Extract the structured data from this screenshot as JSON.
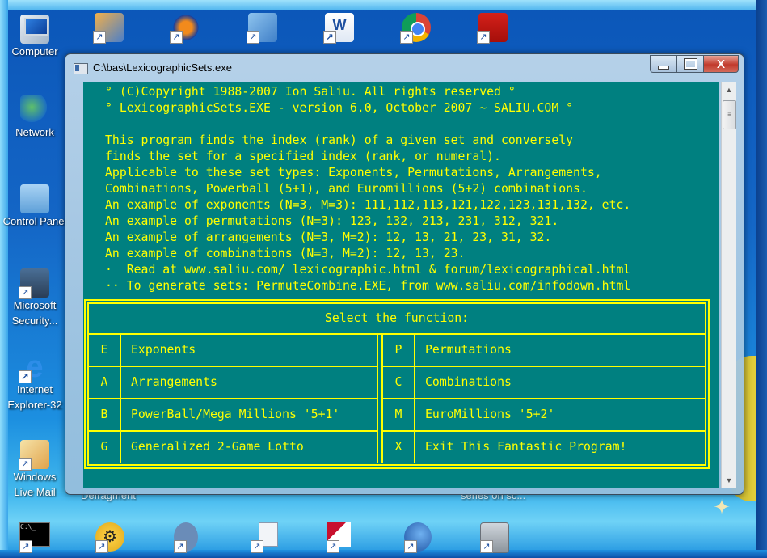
{
  "desktop": {
    "icons_left": [
      {
        "label": "Computer",
        "icon": "computer-icon"
      },
      {
        "label": "Network",
        "icon": "network-icon"
      },
      {
        "label": "Control Panel",
        "icon": "control-panel-icon"
      },
      {
        "label": "Microsoft Security...",
        "icon": "security-shield-icon"
      },
      {
        "label": "Internet Explorer-32",
        "icon": "internet-explorer-icon"
      },
      {
        "label": "Windows Live Mail",
        "icon": "mail-icon"
      }
    ],
    "icons_top": [
      {
        "icon": "media-maker-icon"
      },
      {
        "icon": "audacity-icon"
      },
      {
        "icon": "app-icon"
      },
      {
        "icon": "word-icon"
      },
      {
        "icon": "chrome-icon"
      },
      {
        "icon": "adobe-reader-icon"
      }
    ],
    "partial_labels": [
      "Defragment",
      "series on sc..."
    ],
    "icons_bottom": [
      {
        "icon": "command-prompt-icon"
      },
      {
        "icon": "settings-gear-icon"
      },
      {
        "icon": "app-icon"
      },
      {
        "icon": "document-icon"
      },
      {
        "icon": "editor-icon"
      },
      {
        "icon": "browser-icon"
      },
      {
        "icon": "program-icon"
      }
    ]
  },
  "window": {
    "title": "C:\\bas\\LexicographicSets.exe",
    "buttons": {
      "minimize": "minimize",
      "maximize": "maximize",
      "close": "X"
    }
  },
  "console": {
    "colors": {
      "background": "#008080",
      "text": "#ffff00"
    },
    "lines": [
      "° (C)Copyright 1988-2007 Ion Saliu. All rights reserved °",
      "° LexicographicSets.EXE - version 6.0, October 2007 ~ SALIU.COM °",
      "",
      "This program finds the index (rank) of a given set and conversely",
      "finds the set for a specified index (rank, or numeral).",
      "Applicable to these set types: Exponents, Permutations, Arrangements,",
      "Combinations, Powerball (5+1), and Euromillions (5+2) combinations.",
      "An example of exponents (N=3, M=3): 111,112,113,121,122,123,131,132, etc.",
      "An example of permutations (N=3): 123, 132, 213, 231, 312, 321.",
      "An example of arrangements (N=3, M=2): 12, 13, 21, 23, 31, 32.",
      "An example of combinations (N=3, M=2): 12, 13, 23.",
      "·  Read at www.saliu.com/ lexicographic.html & forum/lexicographical.html",
      "·· To generate sets: PermuteCombine.EXE, from www.saliu.com/infodown.html"
    ],
    "menu": {
      "title": "Select the function:",
      "left": [
        {
          "key": "E",
          "label": "Exponents"
        },
        {
          "key": "A",
          "label": "Arrangements"
        },
        {
          "key": "B",
          "label": "PowerBall/Mega Millions '5+1'"
        },
        {
          "key": "G",
          "label": "Generalized 2-Game Lotto"
        }
      ],
      "right": [
        {
          "key": "P",
          "label": "Permutations"
        },
        {
          "key": "C",
          "label": "Combinations"
        },
        {
          "key": "M",
          "label": "EuroMillions '5+2'"
        },
        {
          "key": "X",
          "label": "Exit This Fantastic Program!"
        }
      ]
    }
  }
}
